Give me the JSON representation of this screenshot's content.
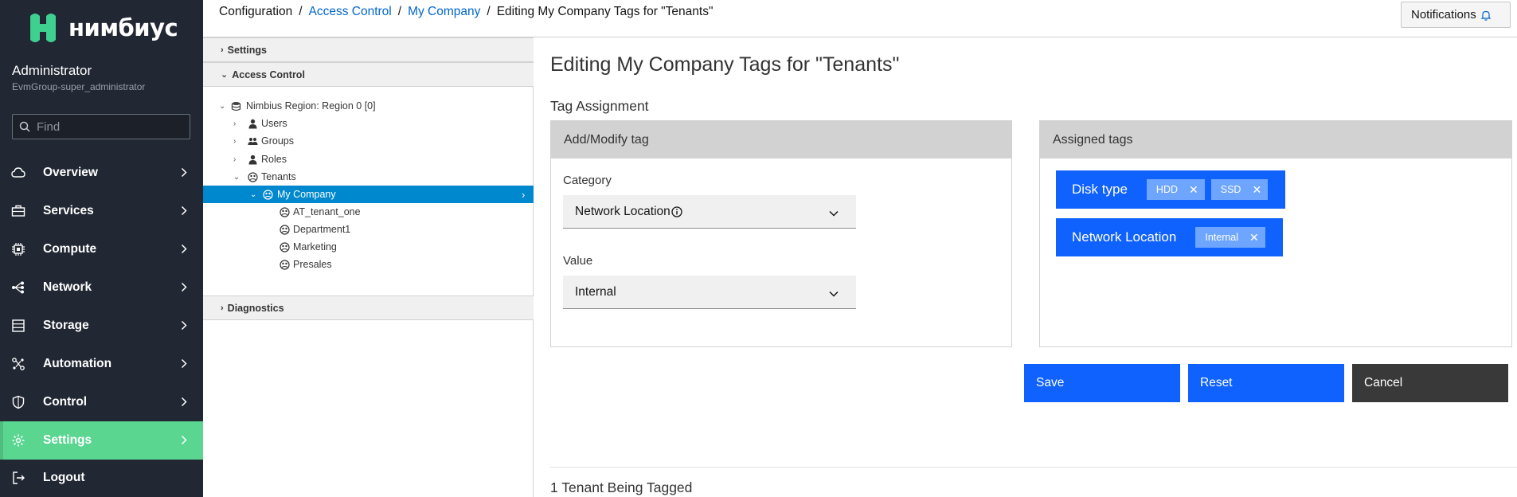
{
  "brand": {
    "name": "нимбиус"
  },
  "user": {
    "name": "Administrator",
    "group": "EvmGroup-super_administrator"
  },
  "search": {
    "placeholder": "Find"
  },
  "nav": [
    {
      "label": "Overview",
      "icon": "cloud-icon"
    },
    {
      "label": "Services",
      "icon": "briefcase-icon"
    },
    {
      "label": "Compute",
      "icon": "cpu-icon"
    },
    {
      "label": "Network",
      "icon": "network-icon"
    },
    {
      "label": "Storage",
      "icon": "database-icon"
    },
    {
      "label": "Automation",
      "icon": "automation-icon"
    },
    {
      "label": "Control",
      "icon": "shield-icon"
    },
    {
      "label": "Settings",
      "icon": "gear-icon",
      "active": true
    },
    {
      "label": "Logout",
      "icon": "logout-icon"
    }
  ],
  "breadcrumb": {
    "root": "Configuration",
    "access_control": "Access Control",
    "company": "My Company",
    "current": "Editing My Company Tags for \"Tenants\"",
    "sep": "/"
  },
  "header": {
    "notifications": "Notifications"
  },
  "tree": {
    "settings": "Settings",
    "access_control": "Access Control",
    "region": "Nimbius Region: Region 0 [0]",
    "users": "Users",
    "groups": "Groups",
    "roles": "Roles",
    "tenants": "Tenants",
    "my_company": "My Company",
    "children": [
      "AT_tenant_one",
      "Department1",
      "Marketing",
      "Presales"
    ],
    "diagnostics": "Diagnostics"
  },
  "main": {
    "title": "Editing My Company Tags for \"Tenants\"",
    "section": "Tag Assignment",
    "add_modify": {
      "heading": "Add/Modify tag",
      "category_label": "Category",
      "category_value": "Network Location",
      "value_label": "Value",
      "value_value": "Internal"
    },
    "assigned": {
      "heading": "Assigned tags",
      "groups": [
        {
          "label": "Disk type",
          "tags": [
            "HDD",
            "SSD"
          ]
        },
        {
          "label": "Network Location",
          "tags": [
            "Internal"
          ]
        }
      ]
    },
    "buttons": {
      "save": "Save",
      "reset": "Reset",
      "cancel": "Cancel"
    },
    "tagged_title": "1 Tenant Being Tagged"
  },
  "colors": {
    "sidebar_bg": "#212733",
    "active_nav": "#5ad691",
    "primary": "#0f62fe",
    "selected_tree": "#0088ce",
    "tag_chip": "#6ea6ff"
  }
}
